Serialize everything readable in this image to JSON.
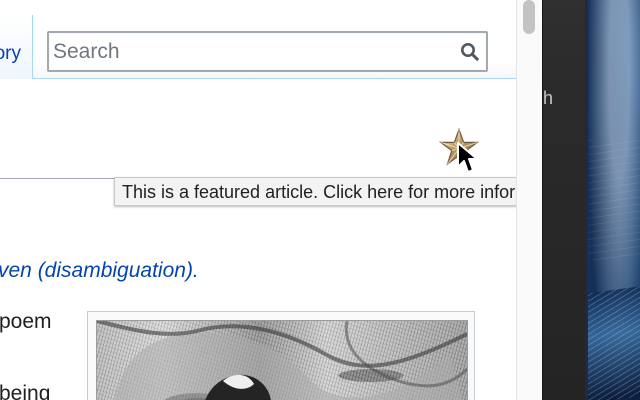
{
  "wiki": {
    "history_tab_label": "ory",
    "search": {
      "placeholder": "Search"
    },
    "featured_star_tooltip": "This is a featured article. Click here for more information.",
    "hatnote_link": "ven (disambiguation).",
    "body_fragments": [
      "poem",
      "being"
    ]
  },
  "browser": {
    "background_window_fragment": "h"
  },
  "icons": {
    "search": "search-icon",
    "featured": "featured-article-star-icon",
    "cursor": "mouse-pointer-icon"
  },
  "colors": {
    "link": "#0645ad",
    "text": "#202122",
    "border": "#a2a9b1",
    "tab_border": "#a7d7f9",
    "tooltip_background": "#f3f3f3",
    "scroll_thumb": "#c3c3c3"
  }
}
